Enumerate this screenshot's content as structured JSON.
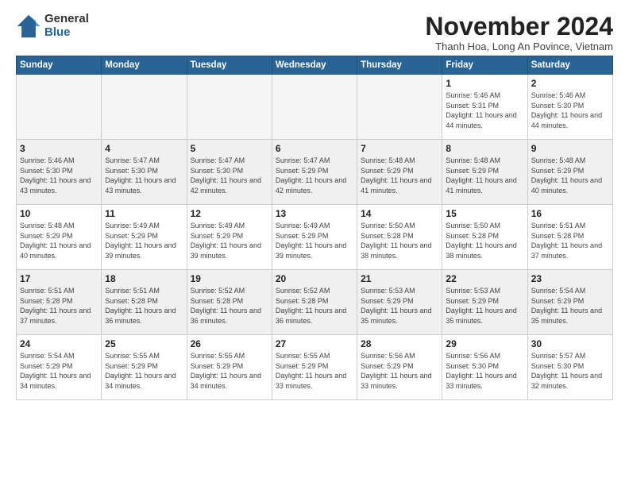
{
  "logo": {
    "general": "General",
    "blue": "Blue"
  },
  "title": "November 2024",
  "subtitle": "Thanh Hoa, Long An Povince, Vietnam",
  "days_of_week": [
    "Sunday",
    "Monday",
    "Tuesday",
    "Wednesday",
    "Thursday",
    "Friday",
    "Saturday"
  ],
  "weeks": [
    [
      {
        "day": "",
        "detail": ""
      },
      {
        "day": "",
        "detail": ""
      },
      {
        "day": "",
        "detail": ""
      },
      {
        "day": "",
        "detail": ""
      },
      {
        "day": "",
        "detail": ""
      },
      {
        "day": "1",
        "detail": "Sunrise: 5:46 AM\nSunset: 5:31 PM\nDaylight: 11 hours and 44 minutes."
      },
      {
        "day": "2",
        "detail": "Sunrise: 5:46 AM\nSunset: 5:30 PM\nDaylight: 11 hours and 44 minutes."
      }
    ],
    [
      {
        "day": "3",
        "detail": "Sunrise: 5:46 AM\nSunset: 5:30 PM\nDaylight: 11 hours and 43 minutes."
      },
      {
        "day": "4",
        "detail": "Sunrise: 5:47 AM\nSunset: 5:30 PM\nDaylight: 11 hours and 43 minutes."
      },
      {
        "day": "5",
        "detail": "Sunrise: 5:47 AM\nSunset: 5:30 PM\nDaylight: 11 hours and 42 minutes."
      },
      {
        "day": "6",
        "detail": "Sunrise: 5:47 AM\nSunset: 5:29 PM\nDaylight: 11 hours and 42 minutes."
      },
      {
        "day": "7",
        "detail": "Sunrise: 5:48 AM\nSunset: 5:29 PM\nDaylight: 11 hours and 41 minutes."
      },
      {
        "day": "8",
        "detail": "Sunrise: 5:48 AM\nSunset: 5:29 PM\nDaylight: 11 hours and 41 minutes."
      },
      {
        "day": "9",
        "detail": "Sunrise: 5:48 AM\nSunset: 5:29 PM\nDaylight: 11 hours and 40 minutes."
      }
    ],
    [
      {
        "day": "10",
        "detail": "Sunrise: 5:48 AM\nSunset: 5:29 PM\nDaylight: 11 hours and 40 minutes."
      },
      {
        "day": "11",
        "detail": "Sunrise: 5:49 AM\nSunset: 5:29 PM\nDaylight: 11 hours and 39 minutes."
      },
      {
        "day": "12",
        "detail": "Sunrise: 5:49 AM\nSunset: 5:29 PM\nDaylight: 11 hours and 39 minutes."
      },
      {
        "day": "13",
        "detail": "Sunrise: 5:49 AM\nSunset: 5:29 PM\nDaylight: 11 hours and 39 minutes."
      },
      {
        "day": "14",
        "detail": "Sunrise: 5:50 AM\nSunset: 5:28 PM\nDaylight: 11 hours and 38 minutes."
      },
      {
        "day": "15",
        "detail": "Sunrise: 5:50 AM\nSunset: 5:28 PM\nDaylight: 11 hours and 38 minutes."
      },
      {
        "day": "16",
        "detail": "Sunrise: 5:51 AM\nSunset: 5:28 PM\nDaylight: 11 hours and 37 minutes."
      }
    ],
    [
      {
        "day": "17",
        "detail": "Sunrise: 5:51 AM\nSunset: 5:28 PM\nDaylight: 11 hours and 37 minutes."
      },
      {
        "day": "18",
        "detail": "Sunrise: 5:51 AM\nSunset: 5:28 PM\nDaylight: 11 hours and 36 minutes."
      },
      {
        "day": "19",
        "detail": "Sunrise: 5:52 AM\nSunset: 5:28 PM\nDaylight: 11 hours and 36 minutes."
      },
      {
        "day": "20",
        "detail": "Sunrise: 5:52 AM\nSunset: 5:28 PM\nDaylight: 11 hours and 36 minutes."
      },
      {
        "day": "21",
        "detail": "Sunrise: 5:53 AM\nSunset: 5:29 PM\nDaylight: 11 hours and 35 minutes."
      },
      {
        "day": "22",
        "detail": "Sunrise: 5:53 AM\nSunset: 5:29 PM\nDaylight: 11 hours and 35 minutes."
      },
      {
        "day": "23",
        "detail": "Sunrise: 5:54 AM\nSunset: 5:29 PM\nDaylight: 11 hours and 35 minutes."
      }
    ],
    [
      {
        "day": "24",
        "detail": "Sunrise: 5:54 AM\nSunset: 5:29 PM\nDaylight: 11 hours and 34 minutes."
      },
      {
        "day": "25",
        "detail": "Sunrise: 5:55 AM\nSunset: 5:29 PM\nDaylight: 11 hours and 34 minutes."
      },
      {
        "day": "26",
        "detail": "Sunrise: 5:55 AM\nSunset: 5:29 PM\nDaylight: 11 hours and 34 minutes."
      },
      {
        "day": "27",
        "detail": "Sunrise: 5:55 AM\nSunset: 5:29 PM\nDaylight: 11 hours and 33 minutes."
      },
      {
        "day": "28",
        "detail": "Sunrise: 5:56 AM\nSunset: 5:29 PM\nDaylight: 11 hours and 33 minutes."
      },
      {
        "day": "29",
        "detail": "Sunrise: 5:56 AM\nSunset: 5:30 PM\nDaylight: 11 hours and 33 minutes."
      },
      {
        "day": "30",
        "detail": "Sunrise: 5:57 AM\nSunset: 5:30 PM\nDaylight: 11 hours and 32 minutes."
      }
    ]
  ]
}
